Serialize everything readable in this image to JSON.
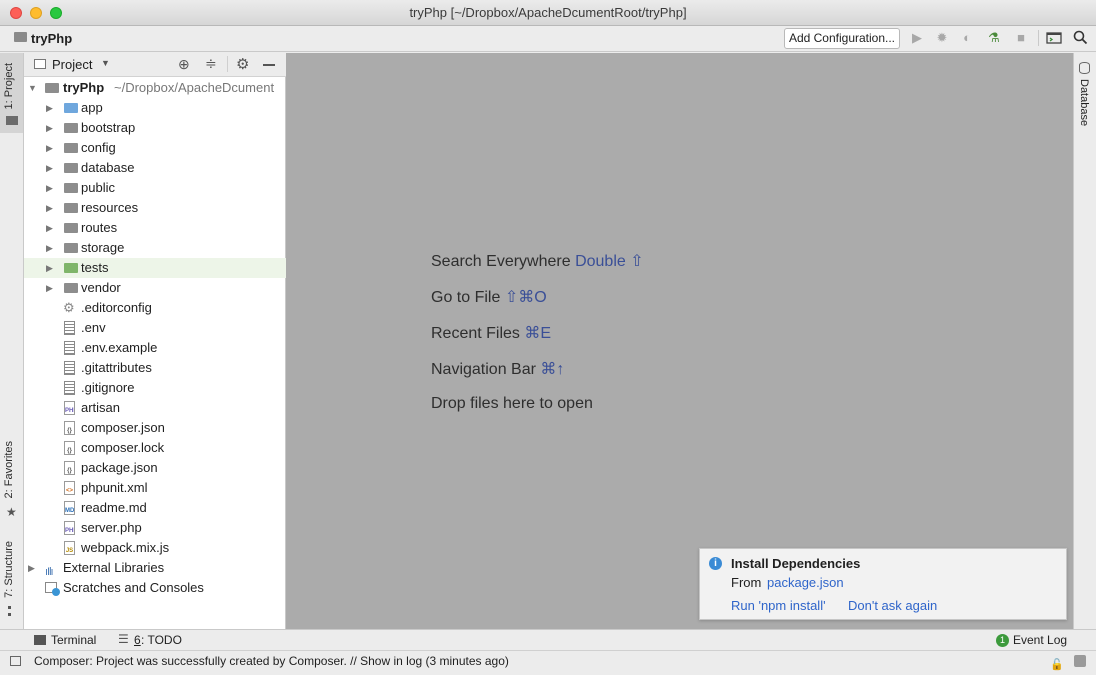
{
  "window": {
    "title": "tryPhp [~/Dropbox/ApacheDcumentRoot/tryPhp]"
  },
  "navbar": {
    "project": "tryPhp",
    "add_configuration": "Add Configuration..."
  },
  "left_tabs": {
    "project": "1: Project",
    "favorites": "2: Favorites",
    "structure": "7: Structure"
  },
  "right_tabs": {
    "database": "Database"
  },
  "project_panel": {
    "header": "Project",
    "root": {
      "name": "tryPhp",
      "path": "~/Dropbox/ApacheDcument"
    },
    "items": [
      {
        "label": "app",
        "kind": "folder",
        "icon": "folder-icon-blue"
      },
      {
        "label": "bootstrap",
        "kind": "folder",
        "icon": "folder-icon"
      },
      {
        "label": "config",
        "kind": "folder",
        "icon": "folder-icon"
      },
      {
        "label": "database",
        "kind": "folder",
        "icon": "folder-icon"
      },
      {
        "label": "public",
        "kind": "folder",
        "icon": "folder-icon"
      },
      {
        "label": "resources",
        "kind": "folder",
        "icon": "folder-icon"
      },
      {
        "label": "routes",
        "kind": "folder",
        "icon": "folder-icon"
      },
      {
        "label": "storage",
        "kind": "folder",
        "icon": "folder-icon"
      },
      {
        "label": "tests",
        "kind": "folder",
        "icon": "folder-icon-green"
      },
      {
        "label": "vendor",
        "kind": "folder",
        "icon": "folder-icon"
      },
      {
        "label": ".editorconfig",
        "kind": "file",
        "icon": "gear-file-icon"
      },
      {
        "label": ".env",
        "kind": "file",
        "icon": "text-file-icon"
      },
      {
        "label": ".env.example",
        "kind": "file",
        "icon": "text-file-icon"
      },
      {
        "label": ".gitattributes",
        "kind": "file",
        "icon": "text-file-icon"
      },
      {
        "label": ".gitignore",
        "kind": "file",
        "icon": "text-file-icon"
      },
      {
        "label": "artisan",
        "kind": "file",
        "icon": "php-file-icon",
        "badge": "PHP"
      },
      {
        "label": "composer.json",
        "kind": "file",
        "icon": "json-file-icon",
        "badge": "{}"
      },
      {
        "label": "composer.lock",
        "kind": "file",
        "icon": "json-file-icon",
        "badge": "{}"
      },
      {
        "label": "package.json",
        "kind": "file",
        "icon": "json-file-icon",
        "badge": "{}"
      },
      {
        "label": "phpunit.xml",
        "kind": "file",
        "icon": "xml-file-icon",
        "badge": "<>"
      },
      {
        "label": "readme.md",
        "kind": "file",
        "icon": "markdown-file-icon",
        "badge": "MD"
      },
      {
        "label": "server.php",
        "kind": "file",
        "icon": "php-file-icon",
        "badge": "PHP"
      },
      {
        "label": "webpack.mix.js",
        "kind": "file",
        "icon": "js-file-icon",
        "badge": "JS"
      }
    ],
    "external_libraries": "External Libraries",
    "scratches": "Scratches and Consoles"
  },
  "editor_hints": [
    {
      "text": "Search Everywhere",
      "key": "Double ⇧"
    },
    {
      "text": "Go to File",
      "key": "⇧⌘O"
    },
    {
      "text": "Recent Files",
      "key": "⌘E"
    },
    {
      "text": "Navigation Bar",
      "key": "⌘↑"
    },
    {
      "text": "Drop files here to open",
      "key": ""
    }
  ],
  "notification": {
    "title": "Install Dependencies",
    "from_label": "From",
    "from_link": "package.json",
    "action_run": "Run 'npm install'",
    "action_dismiss": "Don't ask again"
  },
  "bottom_tools": {
    "terminal": "Terminal",
    "todo_number": "6",
    "todo_text": ": TODO",
    "event_log_count": "1",
    "event_log": "Event Log"
  },
  "status": {
    "message": "Composer: Project was successfully created by Composer. // Show in log (3 minutes ago)"
  },
  "colors": {
    "accent_blue": "#3a4f97",
    "link_blue": "#2f65ca",
    "selection_green": "#edf5e8",
    "editor_bg": "#ababab"
  }
}
